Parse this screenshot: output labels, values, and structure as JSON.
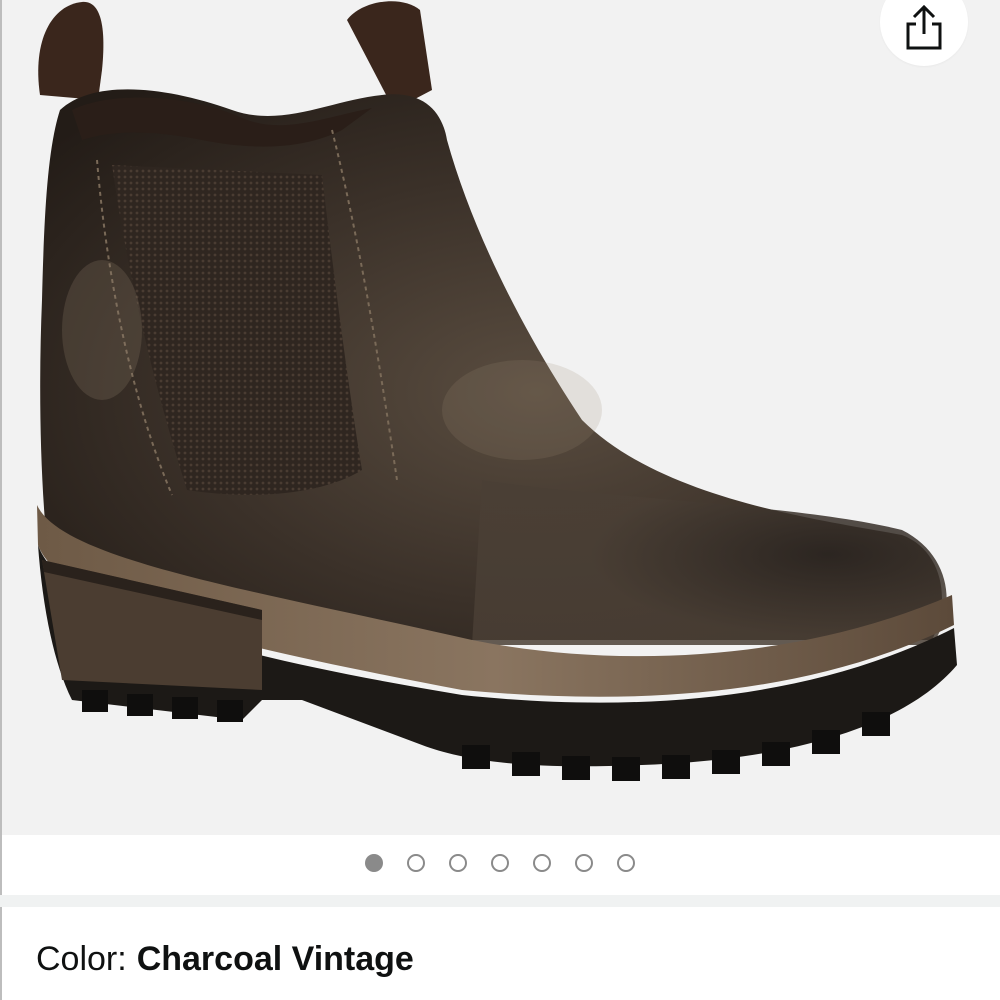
{
  "share": {
    "icon": "share-icon"
  },
  "gallery": {
    "image_alt": "Charcoal Vintage leather chelsea boot",
    "dot_count": 7,
    "active_index": 0
  },
  "color": {
    "label": "Color:",
    "value": "Charcoal Vintage"
  },
  "colors": {
    "dot": "#8a8a8a",
    "text": "#0f1111",
    "divider": "#f0f2f2"
  }
}
